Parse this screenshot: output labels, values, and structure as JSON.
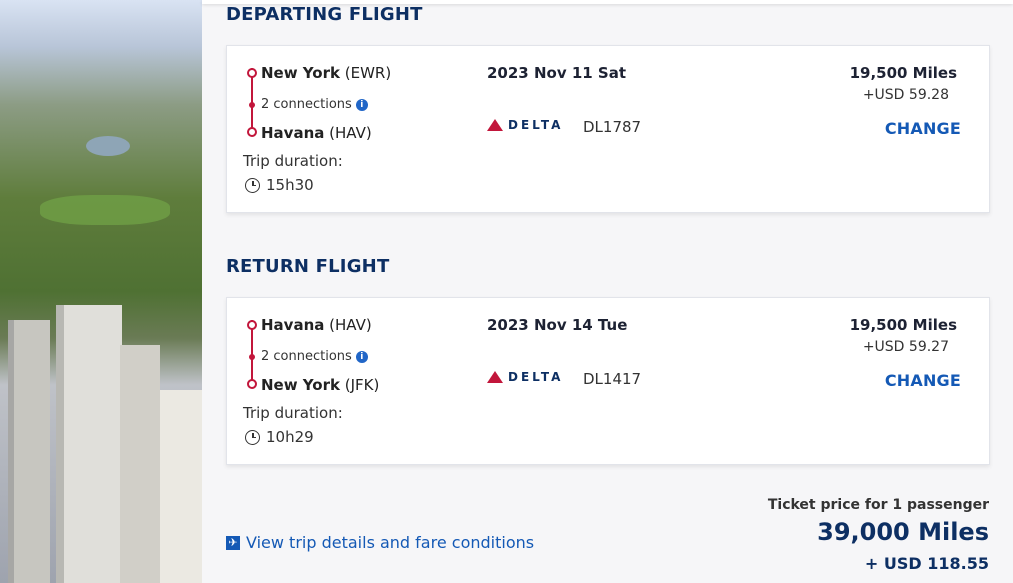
{
  "departing": {
    "section_title": "DEPARTING FLIGHT",
    "origin_city": "New York",
    "origin_code": "(EWR)",
    "connections": "2 connections",
    "destination_city": "Havana",
    "destination_code": "(HAV)",
    "duration_label": "Trip duration:",
    "duration": "15h30",
    "date": "2023 Nov 11 Sat",
    "airline_logo_text": "DELTA",
    "flight_number": "DL1787",
    "miles": "19,500 Miles",
    "usd": "+USD 59.28",
    "change_label": "CHANGE"
  },
  "return": {
    "section_title": "RETURN FLIGHT",
    "origin_city": "Havana",
    "origin_code": "(HAV)",
    "connections": "2 connections",
    "destination_city": "New York",
    "destination_code": "(JFK)",
    "duration_label": "Trip duration:",
    "duration": "10h29",
    "date": "2023 Nov 14 Tue",
    "airline_logo_text": "DELTA",
    "flight_number": "DL1417",
    "miles": "19,500 Miles",
    "usd": "+USD 59.27",
    "change_label": "CHANGE"
  },
  "summary": {
    "details_link": "View trip details and fare conditions",
    "price_label": "Ticket price for 1 passenger",
    "total_miles": "39,000 Miles",
    "total_usd": "+ USD 118.55"
  },
  "icons": {
    "info": "info-icon",
    "clock": "clock-icon",
    "plane": "plane-icon",
    "airline": "delta-logo"
  },
  "colors": {
    "brand_navy": "#0d2f63",
    "accent_red": "#c2163b",
    "link_blue": "#1459b5"
  }
}
